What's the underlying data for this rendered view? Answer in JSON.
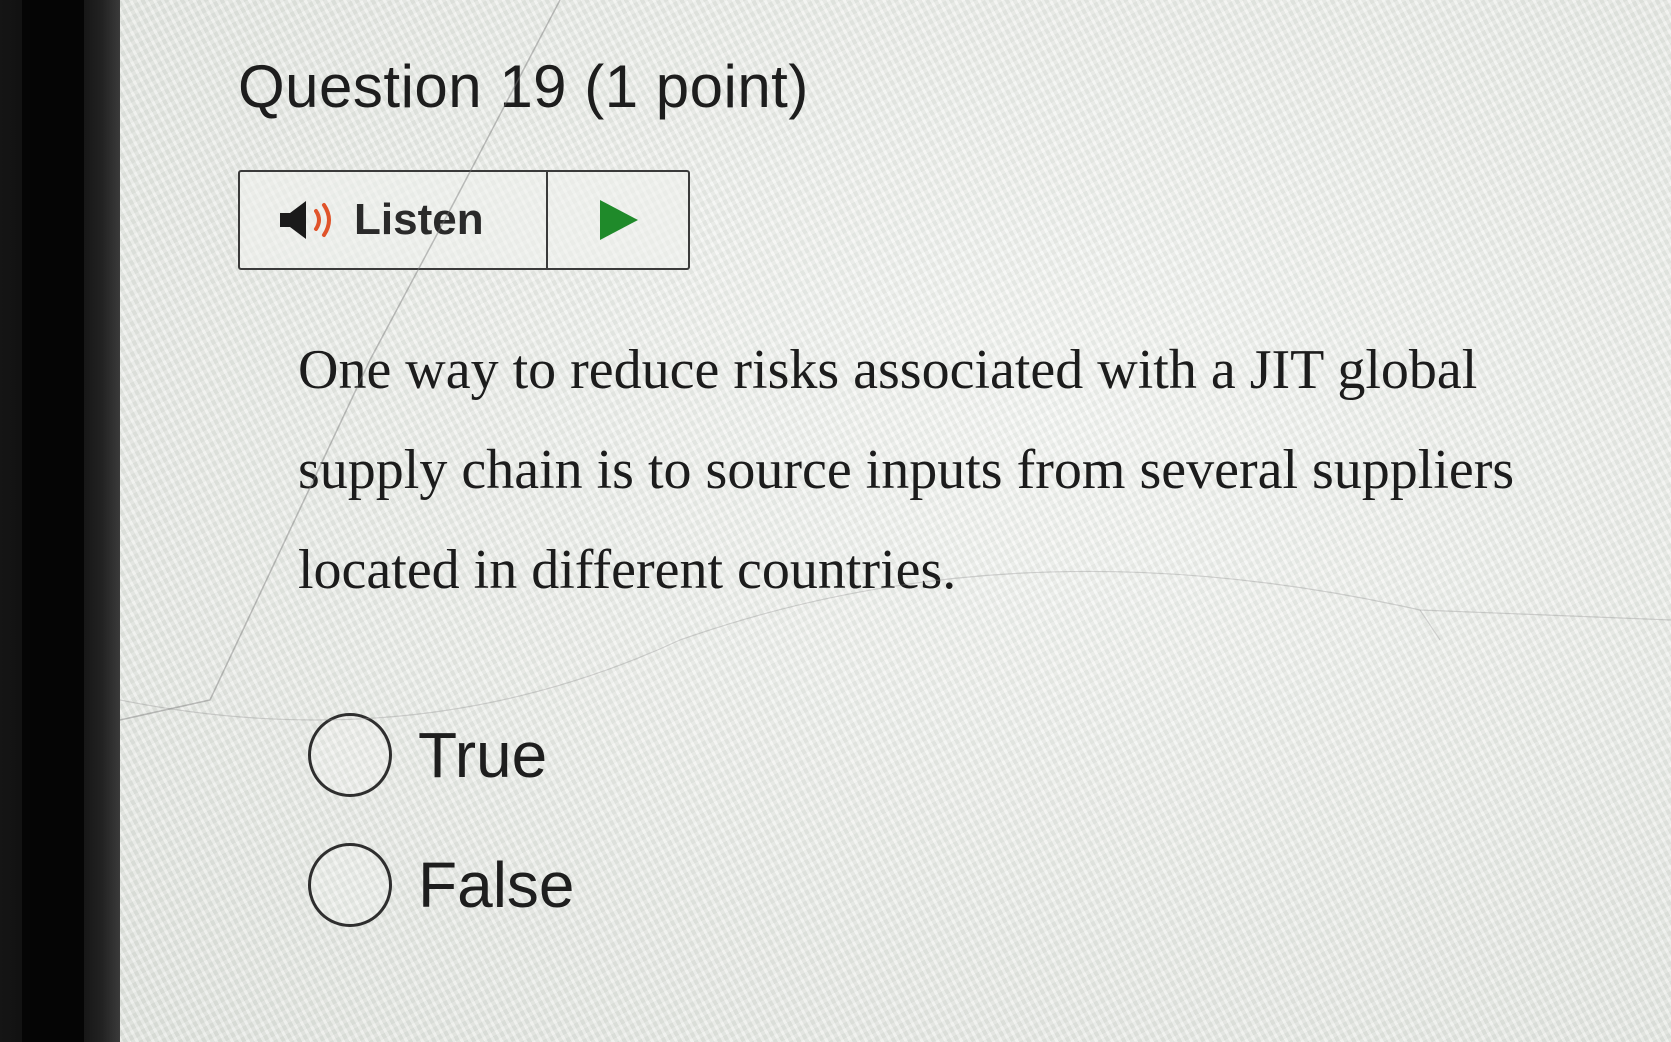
{
  "question": {
    "title": "Question 19 (1 point)",
    "text": "One way to reduce risks associated with a JIT global supply chain is to source inputs from several suppliers located in different countries."
  },
  "listen": {
    "label": "Listen",
    "speaker_icon": "speaker-icon",
    "play_icon": "play-icon",
    "play_color": "#1f8a2a",
    "speaker_color": "#1a1a1a",
    "wave_color": "#e0532a"
  },
  "options": [
    {
      "label": "True",
      "selected": false
    },
    {
      "label": "False",
      "selected": false
    }
  ]
}
